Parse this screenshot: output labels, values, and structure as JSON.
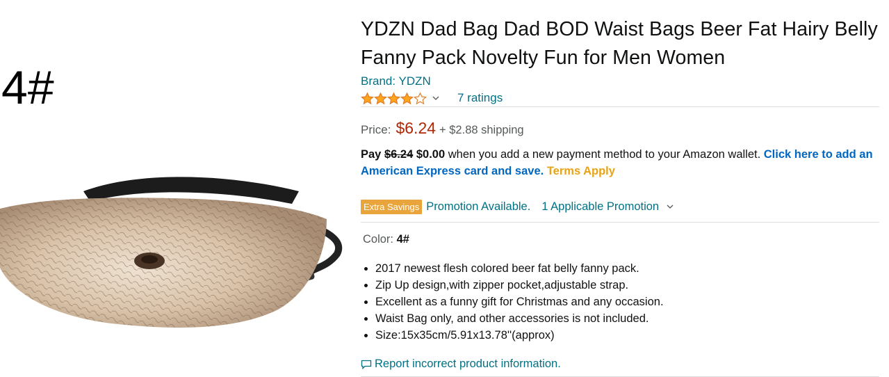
{
  "image": {
    "variant_tag": "4#",
    "alt": "waist bag product image"
  },
  "product": {
    "title": "YDZN Dad Bag Dad BOD Waist Bags Beer Fat Hairy Belly Fanny Pack Novelty Fun for Men Women",
    "brand": "Brand: YDZN",
    "rating_stars": 4,
    "rating_max": 5,
    "ratings_count": "7 ratings"
  },
  "price": {
    "label": "Price:",
    "value": "$6.24",
    "shipping": "+ $2.88 shipping"
  },
  "wallet": {
    "pay": "Pay",
    "old_price": "$6.24",
    "new_price": "$0.00",
    "text": "when you add a new payment method to your Amazon wallet.",
    "link": "Click here to add an American Express card and save.",
    "terms": "Terms Apply"
  },
  "promotion": {
    "badge": "Extra Savings",
    "text": "Promotion Available.",
    "link": "1 Applicable Promotion"
  },
  "color": {
    "label": "Color:",
    "value": "4#"
  },
  "bullets": [
    "2017 newest flesh colored beer fat belly fanny pack.",
    "Zip Up design,with zipper pocket,adjustable strap.",
    "Excellent as a funny gift for Christmas and any occasion.",
    "Waist Bag only, and other accessories is not included.",
    "Size:15x35cm/5.91x13.78''(approx)"
  ],
  "report": {
    "label": "Report incorrect product information.",
    "icon": "speech-bubble-icon"
  },
  "colors": {
    "link": "#007185",
    "price": "#b12704",
    "star": "#ffa41c",
    "badge": "#e9a53b"
  }
}
